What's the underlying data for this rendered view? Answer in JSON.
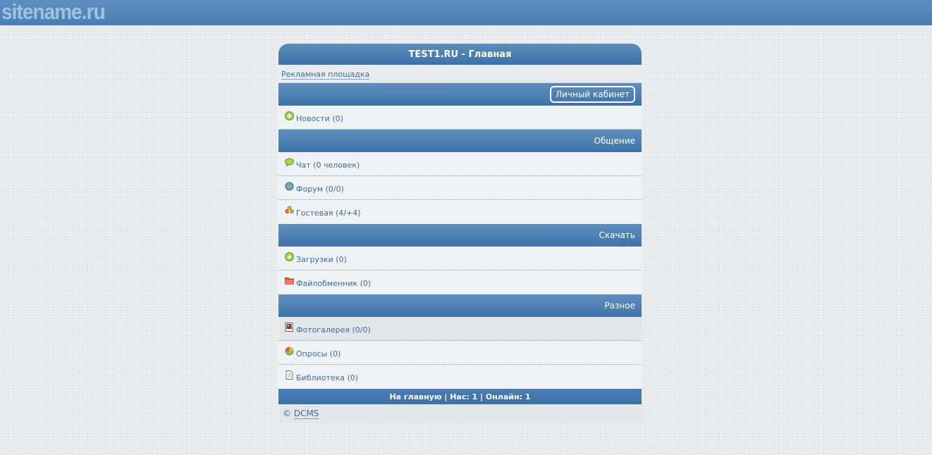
{
  "site": {
    "logo_text": "sitename.ru"
  },
  "page": {
    "title": "TEST1.RU - Главная"
  },
  "ad": {
    "link_text": "Рекламная площадка"
  },
  "account": {
    "cabinet_label": "Личный кабинет"
  },
  "news": {
    "label": "Новости (0)",
    "icon": "plus-circle-icon"
  },
  "sections": {
    "communication": {
      "title": "Общение",
      "items": [
        {
          "label": "Чат (0 человек)",
          "icon": "chat-bubble-icon"
        },
        {
          "label": "Форум (0/0)",
          "icon": "globe-icon"
        },
        {
          "label": "Гостевая (4/+4)",
          "icon": "flower-icon"
        }
      ]
    },
    "download": {
      "title": "Скачать",
      "items": [
        {
          "label": "Загрузки (0)",
          "icon": "download-icon"
        },
        {
          "label": "Файлобменник (0)",
          "icon": "folder-icon"
        }
      ]
    },
    "misc": {
      "title": "Разное",
      "items": [
        {
          "label": "Фотогалерея (0/0)",
          "icon": "photo-icon"
        },
        {
          "label": "Опросы (0)",
          "icon": "pie-chart-icon"
        },
        {
          "label": "Библиотека (0)",
          "icon": "document-icon"
        }
      ]
    }
  },
  "footer": {
    "text": "На главную | Нас: 1 | Онлайн: 1"
  },
  "copyright": {
    "symbol": "©",
    "link_text": "DCMS"
  },
  "colors": {
    "header_blue": "#4a7eb2",
    "link": "#3e6d99",
    "bar_blue": "#3f73a8"
  }
}
